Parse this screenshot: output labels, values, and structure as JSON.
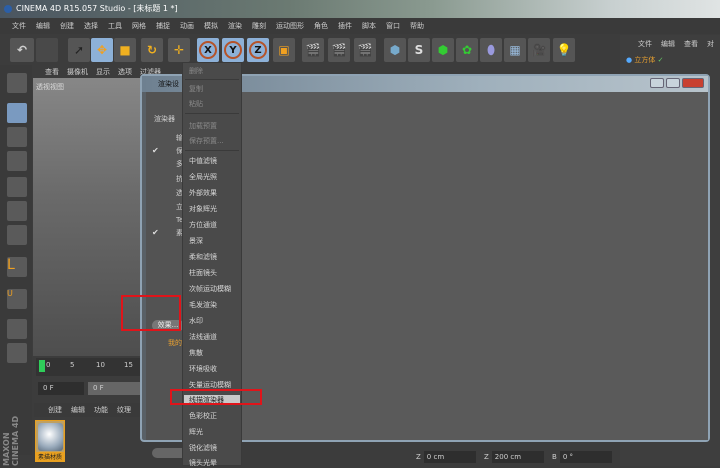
{
  "title": "CINEMA 4D R15.057 Studio - [未标题 1 *]",
  "menu": [
    "文件",
    "编辑",
    "创建",
    "选择",
    "工具",
    "网格",
    "捕捉",
    "动画",
    "模拟",
    "渲染",
    "雕刻",
    "运动图形",
    "角色",
    "插件",
    "脚本",
    "窗口",
    "帮助"
  ],
  "toolbar": {
    "x": "X",
    "y": "Y",
    "z": "Z"
  },
  "right_panel": {
    "menu": [
      "文件",
      "编辑",
      "查看",
      "对"
    ],
    "object": "立方体"
  },
  "viewport": {
    "menu": [
      "查看",
      "摄像机",
      "显示",
      "选项",
      "过滤器"
    ],
    "label": "透视视图"
  },
  "dialog": {
    "title": "渲染设",
    "renderer_label": "渲染器",
    "tree": [
      "输",
      "保存",
      "多通",
      "抗锯",
      "选项",
      "立体",
      "Team",
      "素描"
    ],
    "effects_button": "效果...",
    "mine": "我的"
  },
  "context_menu": {
    "items": [
      "删除",
      "复制",
      "粘贴",
      "加载预置",
      "保存预置...",
      "中值滤镜",
      "全局光照",
      "外部效果",
      "对象辉光",
      "方位通道",
      "景深",
      "柔和滤镜",
      "柱面镜头",
      "次帧运动模糊",
      "毛发渲染",
      "水印",
      "法线通道",
      "焦散",
      "环境吸收",
      "矢量运动模糊",
      "线描渲染器",
      "色彩校正",
      "辉光",
      "锐化滤镜",
      "镜头光晕"
    ],
    "highlighted": "线描渲染器"
  },
  "timeline": {
    "ticks": [
      "0",
      "5",
      "10",
      "15"
    ],
    "start_field": "0 F",
    "current_field": "0 F"
  },
  "material_manager": {
    "menu": [
      "创建",
      "编辑",
      "功能",
      "纹理"
    ],
    "material": "素描材质"
  },
  "brand": "MAXON CINEMA 4D",
  "coords": [
    {
      "axis": "Z",
      "value": "0 cm"
    },
    {
      "axis": "Z",
      "value": "200 cm"
    },
    {
      "axis": "B",
      "value": "0 °"
    }
  ],
  "colors": {
    "highlight_box": "#e0141a",
    "accent": "#e8a020"
  }
}
